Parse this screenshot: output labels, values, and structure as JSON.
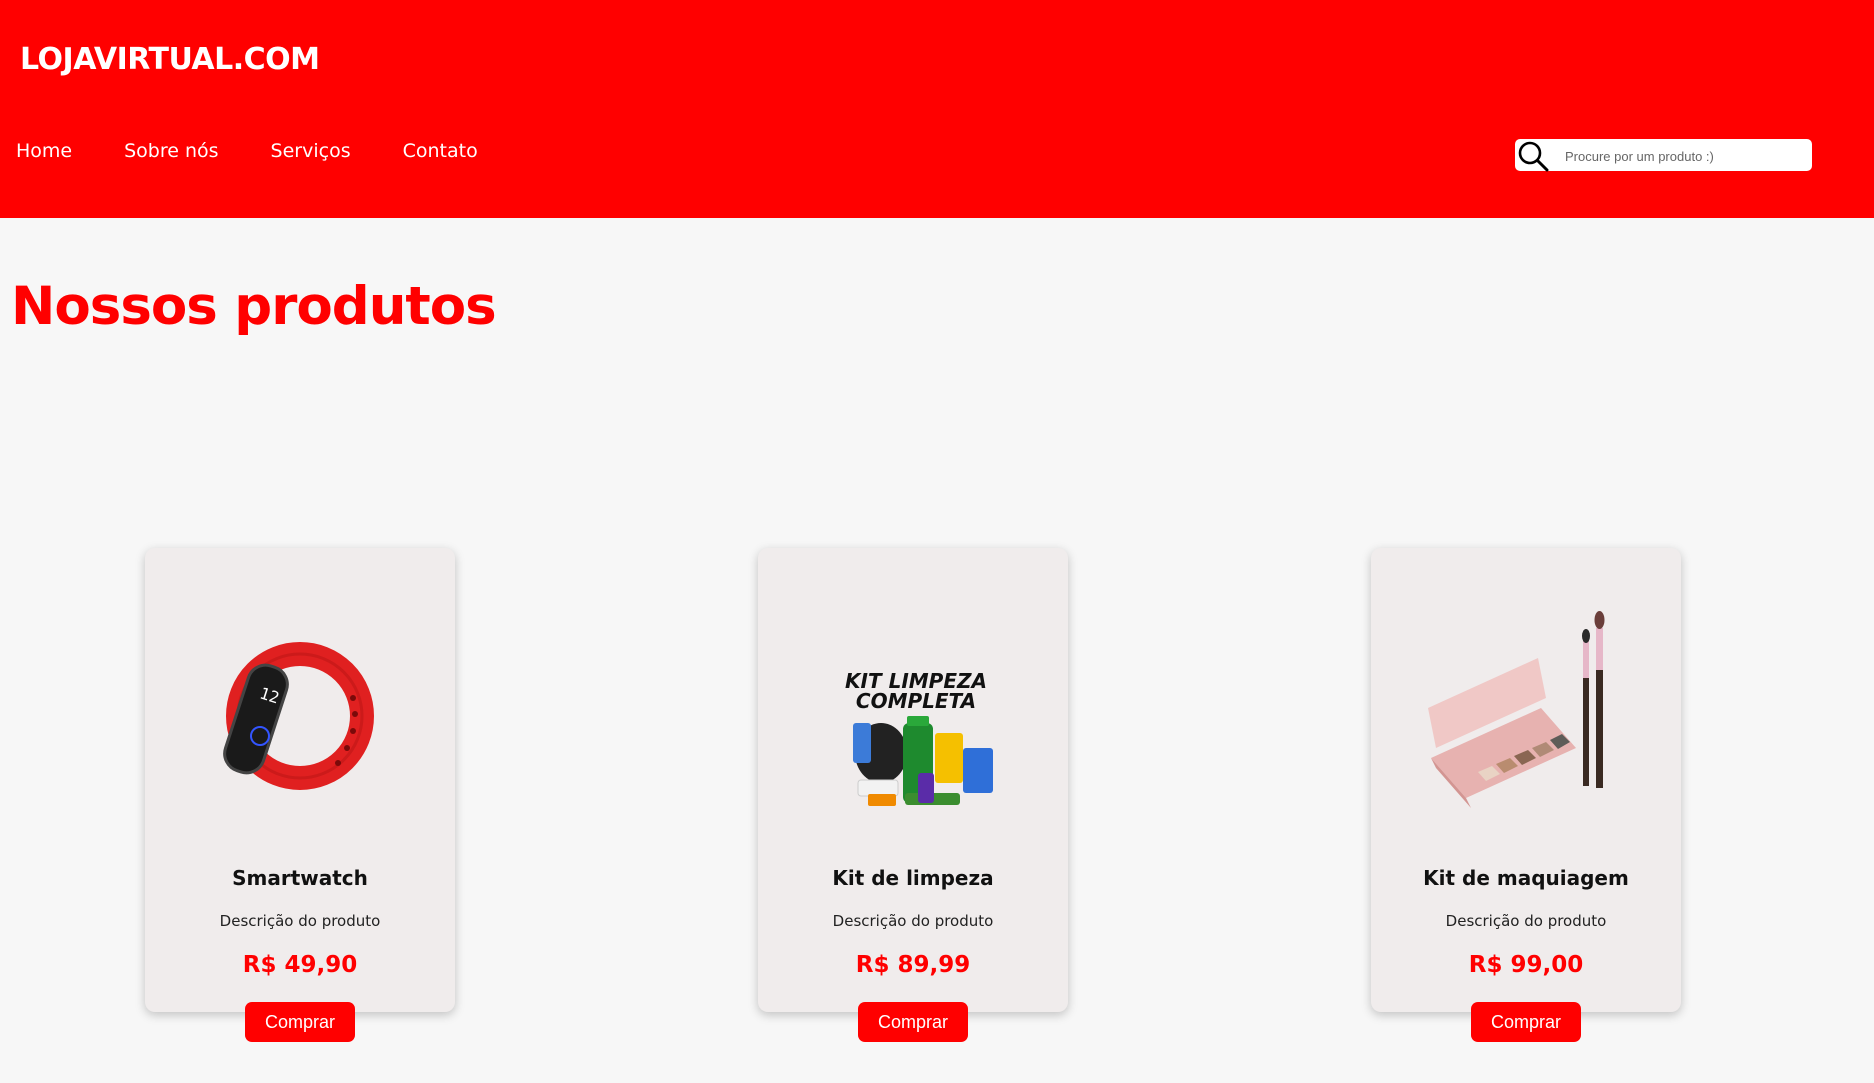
{
  "header": {
    "logo": "LOJAVIRTUAL.COM",
    "nav": [
      "Home",
      "Sobre nós",
      "Serviços",
      "Contato"
    ],
    "search": {
      "placeholder": "Procure por um produto :)",
      "icon": "search-icon"
    }
  },
  "main": {
    "title": "Nossos produtos",
    "products": [
      {
        "name": "Smartwatch",
        "description": "Descrição do produto",
        "price": "R$ 49,90",
        "button": "Comprar",
        "image": "smartwatch-image"
      },
      {
        "name": "Kit de limpeza",
        "description": "Descrição do produto",
        "price": "R$ 89,99",
        "button": "Comprar",
        "image": "cleaning-kit-image",
        "image_text": [
          "KIT LIMPEZA",
          "COMPLETA"
        ]
      },
      {
        "name": "Kit de maquiagem",
        "description": "Descrição do produto",
        "price": "R$ 99,00",
        "button": "Comprar",
        "image": "makeup-kit-image"
      }
    ]
  },
  "colors": {
    "accent": "#ff0000",
    "background": "#f7f7f7",
    "card": "#f0ecec",
    "text_on_accent": "#ffffff"
  }
}
